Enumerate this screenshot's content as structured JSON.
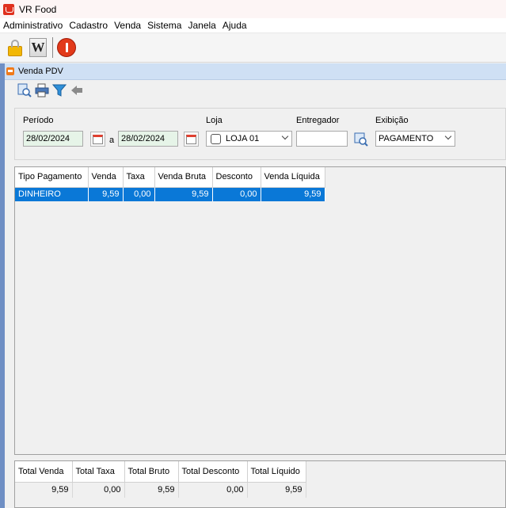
{
  "window": {
    "title": "VR Food"
  },
  "menu": {
    "items": [
      "Administrativo",
      "Cadastro",
      "Venda",
      "Sistema",
      "Janela",
      "Ajuda"
    ]
  },
  "toolbar": {
    "icons": [
      "lock-icon",
      "w-icon",
      "power-icon"
    ],
    "w_label": "W"
  },
  "frame": {
    "title": "Venda PDV"
  },
  "mini_toolbar": {
    "icons": [
      "search-report-icon",
      "print-icon",
      "filter-icon",
      "back-arrow-icon"
    ]
  },
  "filters": {
    "periodo_label": "Período",
    "date_from": "28/02/2024",
    "date_sep": "a",
    "date_to": "28/02/2024",
    "loja_label": "Loja",
    "loja_value": "LOJA 01",
    "entregador_label": "Entregador",
    "entregador_value": "",
    "exibicao_label": "Exibição",
    "exibicao_value": "PAGAMENTO"
  },
  "table": {
    "headers": [
      "Tipo Pagamento",
      "Venda",
      "Taxa",
      "Venda Bruta",
      "Desconto",
      "Venda Líquida"
    ],
    "rows": [
      [
        "DINHEIRO",
        "9,59",
        "0,00",
        "9,59",
        "0,00",
        "9,59"
      ]
    ]
  },
  "totals": {
    "headers": [
      "Total Venda",
      "Total Taxa",
      "Total Bruto",
      "Total Desconto",
      "Total Líquido"
    ],
    "values": [
      "9,59",
      "0,00",
      "9,59",
      "0,00",
      "9,59"
    ]
  },
  "colors": {
    "selection": "#0a78d7",
    "frame_title_bg": "#cfe0f4",
    "date_field_bg": "#e6f4e8"
  }
}
